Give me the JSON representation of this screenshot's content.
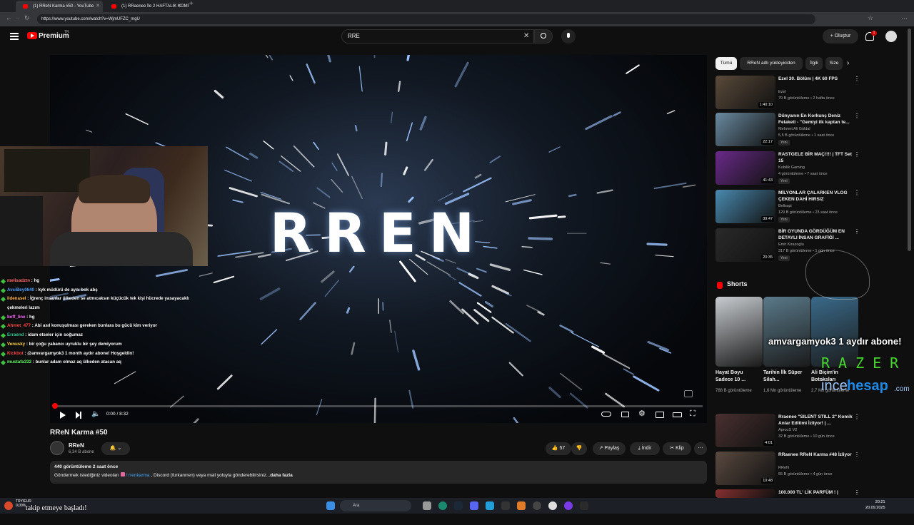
{
  "browser": {
    "tabs": [
      {
        "label": "(1) RReN Karma #50 - YouTube",
        "active": true
      },
      {
        "label": "(1) RRaenee İle 2 HAFTALIK KOMİ",
        "active": false
      }
    ],
    "url": "https://www.youtube.com/watch?v=WjmUFZC_mgU"
  },
  "header": {
    "brand": "Premium",
    "brand_sup": "TR",
    "search_value": "RRE",
    "create_label": "Oluştur",
    "notifications": "1"
  },
  "player": {
    "overlay_text": "RREN",
    "time": "0:00 / 8:32",
    "progress": 0.0
  },
  "chat": [
    {
      "nick": "melisadztn",
      "msg": "hg",
      "color": "#ff6b6b"
    },
    {
      "nick": "AvciBey0640",
      "msg": "kyk müdürü de aynı bok abş",
      "color": "#4fa3ff"
    },
    {
      "nick": "ildenasel",
      "msg": "İğrenç insanlar ülkeden se atmıcaksın küçücük tek kişi hücrede yasayacaklı",
      "color": "#ffb84d"
    },
    {
      "nick": "",
      "msg": "çekmeleri lazım",
      "color": "#ffffff"
    },
    {
      "nick": "beff_line",
      "msg": "hg",
      "color": "#ff66ff"
    },
    {
      "nick": "Ahmet_477",
      "msg": "Abi asıl konuşulması gereken bunlara bu gücü kim veriyor",
      "color": "#ff4444"
    },
    {
      "nick": "Erraend",
      "msg": "idam etseler için soğumaz",
      "color": "#33cc99"
    },
    {
      "nick": "Venusky",
      "msg": "bir çoğu yabancı uyruklu bir şey demiyorum",
      "color": "#ffd24d"
    },
    {
      "nick": "Kickbot",
      "msg": "@amvargamyok3 1 month aydır abone! Hoşgeldin!",
      "color": "#ff4444"
    },
    {
      "nick": "mustafa332",
      "msg": "bunlar adam olmaz aq ülkeden atacan aq",
      "color": "#66ff66"
    }
  ],
  "video": {
    "title": "RReN Karma #50",
    "channel": "RReN",
    "subs": "6,34 B abone",
    "likes": "57",
    "share_label": "Paylaş",
    "download_label": "İndir",
    "clip_label": "Klip",
    "views_date": "440 görüntüleme  2 saat önce",
    "desc_prefix": "Göndermek istediğiniz videoları",
    "desc_link": "/ rrenkarma",
    "desc_suffix": ", Discord (furkanrren) veya mail yoluyla gönderebilirsiniz.",
    "more_label": "daha fazla"
  },
  "chips": [
    "Tümü",
    "RReN adlı yükleyiciden",
    "İlgili",
    "Size"
  ],
  "recommendations": [
    {
      "title": "Ezel 30. Bölüm | 4K 60 FPS",
      "channel": "Ezel",
      "meta": "79 B görüntüleme • 2 hafta önce",
      "duration": "1:40:10",
      "badge": "",
      "color": "#5a4a3a"
    },
    {
      "title": "Dünyanın En Korkunç Deniz Felaketi - \"Gemiyi ilk kaptan te...",
      "channel": "Mehmet Ali Güldal",
      "meta": "5,5 B görüntüleme • 1 saat önce",
      "duration": "22:17",
      "badge": "Yeni",
      "color": "#6a8aa0"
    },
    {
      "title": "RASTGELE BİR MAÇ!!!! | TFT Set 15",
      "channel": "Kubilik Gaming",
      "meta": "4 görüntüleme • 7 saat önce",
      "duration": "41:43",
      "badge": "Yeni",
      "color": "#6a2a8a"
    },
    {
      "title": "MİLYONLAR ÇALARKEN VLOG ÇEKEN DAHİ HIRSIZ",
      "channel": "Beltrapi",
      "meta": "129 B görüntüleme • 23 saat önce",
      "duration": "39:47",
      "badge": "Yeni",
      "color": "#4a8ab0"
    },
    {
      "title": "BİR OYUNDA GÖRDÜĞÜM EN DETAYLI İNSAN GRAFİĞİ ...",
      "channel": "Emir Kirazoglu",
      "meta": "317 B görüntüleme • 1 gün önce",
      "duration": "20:35",
      "badge": "Yeni",
      "color": "#2a2a2a"
    },
    {
      "title": "Rraenee \"SILENT STILL 2\" Komik Anlar Editimi İzliyor! | ...",
      "channel": "AprcuS V2",
      "meta": "32 B görüntüleme • 10 gün önce",
      "duration": "4:01",
      "badge": "",
      "color": "#4a3030"
    },
    {
      "title": "RRaenee RReN Karma #48 İzliyor",
      "channel": "RReN",
      "meta": "55 B görüntüleme • 4 gün önce",
      "duration": "10:48",
      "badge": "",
      "color": "#5a4a40"
    },
    {
      "title": "100.000 TL' LİK PARFÜM ! |",
      "channel": "",
      "meta": "",
      "duration": "",
      "badge": "",
      "color": "#883030"
    }
  ],
  "shorts": {
    "heading": "Shorts",
    "items": [
      {
        "title": "Hayat Boyu Sadece 10 ...",
        "views": "788 B görüntüleme",
        "color": "#c8ccd0"
      },
      {
        "title": "Tarihin İlk Süper Silah...",
        "views": "1,6 Mn görüntüleme",
        "color": "#5a7a8a"
      },
      {
        "title": "Ali Biçim'in Botoksları",
        "views": "2,7 Mn görüntüleme",
        "color": "#3a6a8a"
      }
    ]
  },
  "overlays": {
    "alert": "amvargamyok3  1 aydır abone!",
    "sponsor": "RAZER",
    "watermark_a": "ince",
    "watermark_b": "hesap",
    "watermark_c": ".com",
    "follow": "takip etmeye başladı!"
  },
  "taskbar": {
    "search_placeholder": "Ara",
    "weather_a": "TRY/EUR",
    "weather_b": "0,00%",
    "time": "20:21",
    "date": "20.09.2025"
  }
}
